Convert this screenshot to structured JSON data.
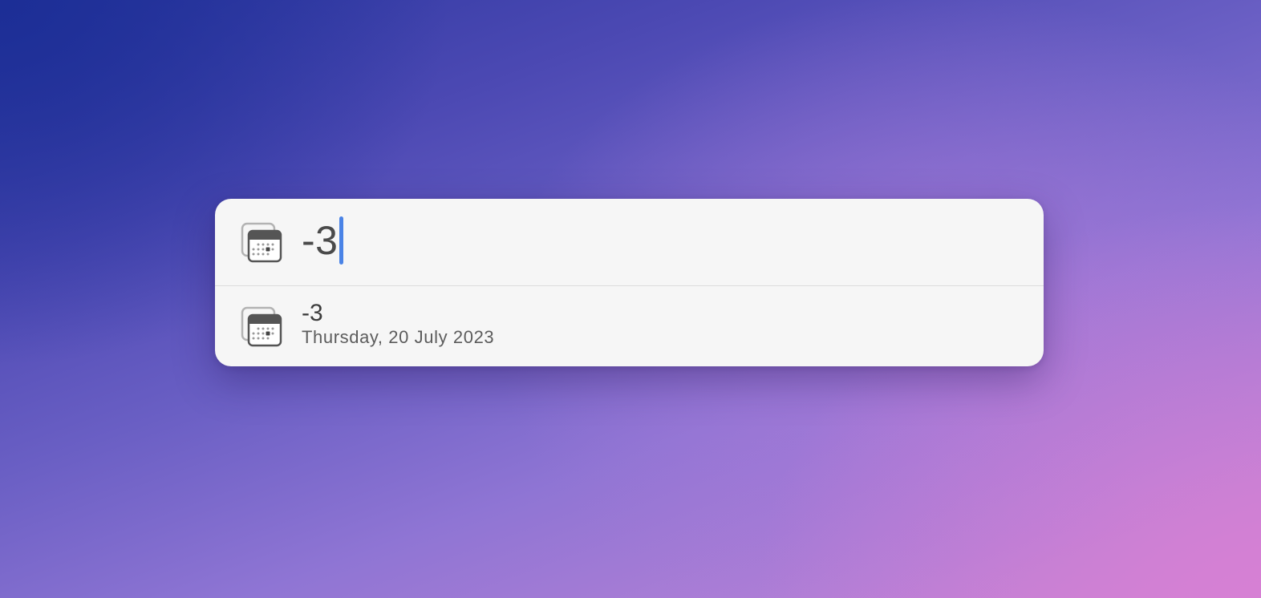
{
  "search": {
    "query": "-3",
    "icon": "calendar-icon"
  },
  "results": [
    {
      "title": "-3",
      "subtitle": "Thursday, 20 July 2023",
      "icon": "calendar-icon"
    }
  ],
  "colors": {
    "caret": "#4a83e6",
    "panel_background": "#f6f6f6"
  }
}
